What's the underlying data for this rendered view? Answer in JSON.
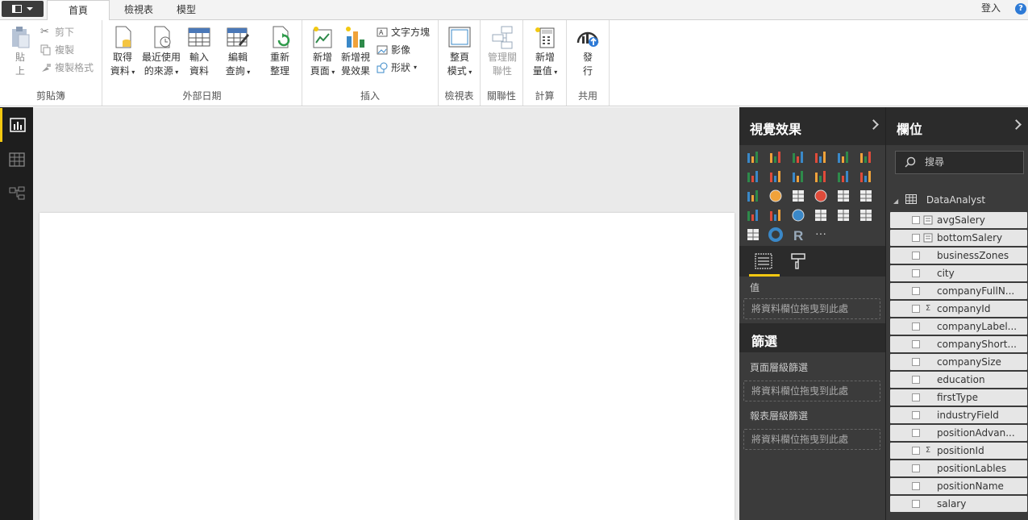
{
  "tabs": {
    "home": "首頁",
    "view": "檢視表",
    "model": "模型",
    "login": "登入",
    "help": "?"
  },
  "ribbon": {
    "clipboard": {
      "paste": "貼上",
      "cut": "剪下",
      "copy": "複製",
      "format_copy": "複製格式",
      "label": "剪貼簿"
    },
    "external": {
      "get_data": "取得",
      "get_data2": "資料",
      "recent": "最近使用",
      "recent2": "的來源",
      "enter": "輸入",
      "enter2": "資料",
      "edit": "編輯",
      "edit2": "查詢",
      "refresh": "重新",
      "refresh2": "整理",
      "label": "外部日期"
    },
    "insert": {
      "new_page": "新增",
      "new_page2": "頁面",
      "new_visual": "新增視",
      "new_visual2": "覺效果",
      "textbox": "文字方塊",
      "image": "影像",
      "shapes": "形狀",
      "label": "插入"
    },
    "view": {
      "page_view": "整頁",
      "page_view2": "模式",
      "label": "檢視表"
    },
    "relations": {
      "manage": "管理關",
      "manage2": "聯性",
      "label": "關聯性"
    },
    "calc": {
      "new_measure": "新增",
      "new_measure2": "量值",
      "label": "計算"
    },
    "share": {
      "publish": "發",
      "publish2": "行",
      "label": "共用"
    }
  },
  "viz_pane": {
    "title": "視覺效果",
    "values_label": "值",
    "drop_hint": "將資料欄位拖曳到此處"
  },
  "filters": {
    "title": "篩選",
    "page_level": "頁面層級篩選",
    "page_drop": "將資料欄位拖曳到此處",
    "report_level": "報表層級篩選",
    "report_drop": "將資料欄位拖曳到此處"
  },
  "fields_pane": {
    "title": "欄位",
    "search_placeholder": "搜尋",
    "table": "DataAnalyst",
    "fields": [
      {
        "name": "avgSalery",
        "type": "calc"
      },
      {
        "name": "bottomSalery",
        "type": "calc"
      },
      {
        "name": "businessZones",
        "type": ""
      },
      {
        "name": "city",
        "type": ""
      },
      {
        "name": "companyFullN...",
        "type": ""
      },
      {
        "name": "companyId",
        "type": "sum"
      },
      {
        "name": "companyLabel...",
        "type": ""
      },
      {
        "name": "companyShort...",
        "type": ""
      },
      {
        "name": "companySize",
        "type": ""
      },
      {
        "name": "education",
        "type": ""
      },
      {
        "name": "firstType",
        "type": ""
      },
      {
        "name": "industryField",
        "type": ""
      },
      {
        "name": "positionAdvan...",
        "type": ""
      },
      {
        "name": "positionId",
        "type": "sum"
      },
      {
        "name": "positionLables",
        "type": ""
      },
      {
        "name": "positionName",
        "type": ""
      },
      {
        "name": "salary",
        "type": ""
      }
    ]
  },
  "colors": {
    "accent": "#f2c811",
    "pane": "#3b3b3b",
    "pane_header": "#2b2b2b",
    "rail": "#1e1e1e"
  }
}
